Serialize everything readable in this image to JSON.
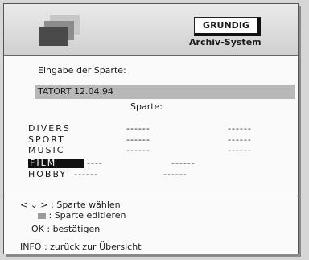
{
  "header": {
    "brand": "GRUNDIG",
    "subtitle": "Archiv-System"
  },
  "form": {
    "prompt": "Eingabe der Sparte:",
    "input_value": "TATORT 12.04.94",
    "field_label": "Sparte:"
  },
  "categories": [
    {
      "name": "DIVERS",
      "col2": "------",
      "col3": "------"
    },
    {
      "name": "SPORT",
      "col2": "------",
      "col3": "------"
    },
    {
      "name": "MUSIC",
      "col2": "------",
      "col3": "------"
    },
    {
      "name": "FILM",
      "col1": "----",
      "col2": "------",
      "selected": true
    },
    {
      "name": "HOBBY",
      "col1": "------",
      "col2": "------"
    }
  ],
  "help": {
    "line1": "< ⌄ > : Sparte wählen",
    "line2": ": Sparte editieren",
    "line3": "OK : bestätigen",
    "line4": "INFO : zurück zur Übersicht"
  }
}
